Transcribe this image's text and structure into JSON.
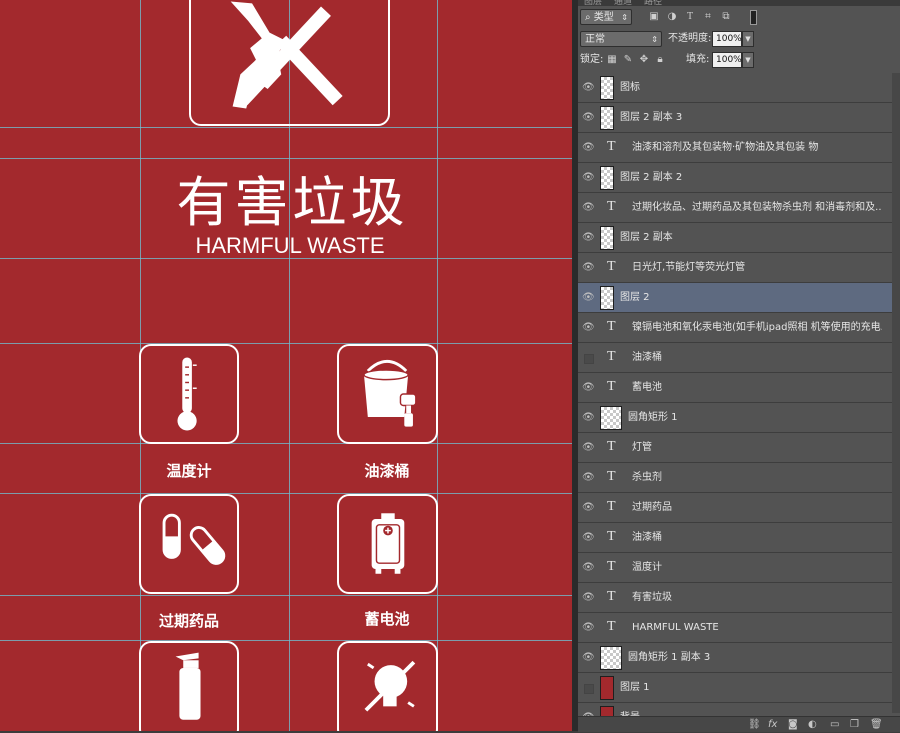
{
  "canvas": {
    "title_cn": "有害垃圾",
    "title_en": "HARMFUL WASTE",
    "background_color": "#a3292d",
    "guide_color": "#6fc3d6",
    "icons": [
      {
        "name": "thermometer-icon",
        "label": "温度计"
      },
      {
        "name": "paint-bucket-icon",
        "label": "油漆桶"
      },
      {
        "name": "pills-icon",
        "label": "过期药品"
      },
      {
        "name": "battery-icon",
        "label": "蓄电池"
      },
      {
        "name": "spray-can-icon",
        "label": ""
      },
      {
        "name": "light-bulb-crossed-icon",
        "label": ""
      }
    ]
  },
  "panel": {
    "tabs": [
      "图层",
      "通道",
      "路径"
    ],
    "filter_kind": "类型",
    "blend_mode": "正常",
    "opacity_label": "不透明度:",
    "opacity_value": "100%",
    "lock_label": "锁定:",
    "fill_label": "填充:",
    "fill_value": "100%",
    "layers": [
      {
        "name": "图标",
        "type": "raster",
        "visible": true,
        "selected": false
      },
      {
        "name": "图层 2 副本 3",
        "type": "raster",
        "visible": true,
        "selected": false
      },
      {
        "name": "油漆和溶剂及其包装物·矿物油及其包装 物",
        "type": "text",
        "visible": true,
        "selected": false
      },
      {
        "name": "图层 2 副本 2",
        "type": "raster",
        "visible": true,
        "selected": false
      },
      {
        "name": "过期化妆品、过期药品及其包装物杀虫剂 和消毒剂和及...",
        "type": "text",
        "visible": true,
        "selected": false
      },
      {
        "name": "图层 2 副本",
        "type": "raster",
        "visible": true,
        "selected": false
      },
      {
        "name": "日光灯,节能灯等荧光灯管",
        "type": "text",
        "visible": true,
        "selected": false
      },
      {
        "name": "图层 2",
        "type": "raster",
        "visible": true,
        "selected": true
      },
      {
        "name": "镍镉电池和氧化汞电池(如手机ipad照相 机等使用的充电...",
        "type": "text",
        "visible": true,
        "selected": false
      },
      {
        "name": "油漆桶",
        "type": "text",
        "visible": false,
        "selected": false
      },
      {
        "name": "蓄电池",
        "type": "text",
        "visible": true,
        "selected": false
      },
      {
        "name": "圆角矩形 1",
        "type": "shape",
        "visible": true,
        "selected": false
      },
      {
        "name": "灯管",
        "type": "text",
        "visible": true,
        "selected": false
      },
      {
        "name": "杀虫剂",
        "type": "text",
        "visible": true,
        "selected": false
      },
      {
        "name": "过期药品",
        "type": "text",
        "visible": true,
        "selected": false
      },
      {
        "name": "油漆桶",
        "type": "text",
        "visible": true,
        "selected": false
      },
      {
        "name": "温度计",
        "type": "text",
        "visible": true,
        "selected": false
      },
      {
        "name": "有害垃圾",
        "type": "text",
        "visible": true,
        "selected": false
      },
      {
        "name": "HARMFUL WASTE",
        "type": "text",
        "visible": true,
        "selected": false
      },
      {
        "name": "圆角矩形 1 副本 3",
        "type": "shape",
        "visible": true,
        "selected": false
      },
      {
        "name": "图层 1",
        "type": "red",
        "visible": false,
        "selected": false
      },
      {
        "name": "背景",
        "type": "red",
        "visible": true,
        "selected": false
      }
    ],
    "bottom_icons": [
      "link-icon",
      "fx-icon",
      "mask-icon",
      "adjustment-icon",
      "folder-icon",
      "new-layer-icon",
      "trash-icon"
    ]
  }
}
